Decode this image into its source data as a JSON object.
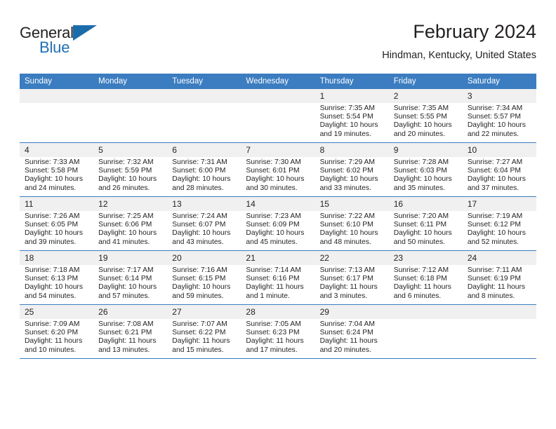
{
  "logo": {
    "word_one": "General",
    "word_two": "Blue",
    "triangle_color": "#1b6cab",
    "blue_color": "#1f6fb2"
  },
  "header": {
    "month_title": "February 2024",
    "location": "Hindman, Kentucky, United States",
    "header_bg": "#3b7dc0",
    "daynum_bg": "#f0f0f0"
  },
  "weekday_headers": [
    "Sunday",
    "Monday",
    "Tuesday",
    "Wednesday",
    "Thursday",
    "Friday",
    "Saturday"
  ],
  "weeks": [
    [
      {
        "day": "",
        "sunrise": "",
        "sunset": "",
        "daylight_1": "",
        "daylight_2": ""
      },
      {
        "day": "",
        "sunrise": "",
        "sunset": "",
        "daylight_1": "",
        "daylight_2": ""
      },
      {
        "day": "",
        "sunrise": "",
        "sunset": "",
        "daylight_1": "",
        "daylight_2": ""
      },
      {
        "day": "",
        "sunrise": "",
        "sunset": "",
        "daylight_1": "",
        "daylight_2": ""
      },
      {
        "day": "1",
        "sunrise": "Sunrise: 7:35 AM",
        "sunset": "Sunset: 5:54 PM",
        "daylight_1": "Daylight: 10 hours",
        "daylight_2": "and 19 minutes."
      },
      {
        "day": "2",
        "sunrise": "Sunrise: 7:35 AM",
        "sunset": "Sunset: 5:55 PM",
        "daylight_1": "Daylight: 10 hours",
        "daylight_2": "and 20 minutes."
      },
      {
        "day": "3",
        "sunrise": "Sunrise: 7:34 AM",
        "sunset": "Sunset: 5:57 PM",
        "daylight_1": "Daylight: 10 hours",
        "daylight_2": "and 22 minutes."
      }
    ],
    [
      {
        "day": "4",
        "sunrise": "Sunrise: 7:33 AM",
        "sunset": "Sunset: 5:58 PM",
        "daylight_1": "Daylight: 10 hours",
        "daylight_2": "and 24 minutes."
      },
      {
        "day": "5",
        "sunrise": "Sunrise: 7:32 AM",
        "sunset": "Sunset: 5:59 PM",
        "daylight_1": "Daylight: 10 hours",
        "daylight_2": "and 26 minutes."
      },
      {
        "day": "6",
        "sunrise": "Sunrise: 7:31 AM",
        "sunset": "Sunset: 6:00 PM",
        "daylight_1": "Daylight: 10 hours",
        "daylight_2": "and 28 minutes."
      },
      {
        "day": "7",
        "sunrise": "Sunrise: 7:30 AM",
        "sunset": "Sunset: 6:01 PM",
        "daylight_1": "Daylight: 10 hours",
        "daylight_2": "and 30 minutes."
      },
      {
        "day": "8",
        "sunrise": "Sunrise: 7:29 AM",
        "sunset": "Sunset: 6:02 PM",
        "daylight_1": "Daylight: 10 hours",
        "daylight_2": "and 33 minutes."
      },
      {
        "day": "9",
        "sunrise": "Sunrise: 7:28 AM",
        "sunset": "Sunset: 6:03 PM",
        "daylight_1": "Daylight: 10 hours",
        "daylight_2": "and 35 minutes."
      },
      {
        "day": "10",
        "sunrise": "Sunrise: 7:27 AM",
        "sunset": "Sunset: 6:04 PM",
        "daylight_1": "Daylight: 10 hours",
        "daylight_2": "and 37 minutes."
      }
    ],
    [
      {
        "day": "11",
        "sunrise": "Sunrise: 7:26 AM",
        "sunset": "Sunset: 6:05 PM",
        "daylight_1": "Daylight: 10 hours",
        "daylight_2": "and 39 minutes."
      },
      {
        "day": "12",
        "sunrise": "Sunrise: 7:25 AM",
        "sunset": "Sunset: 6:06 PM",
        "daylight_1": "Daylight: 10 hours",
        "daylight_2": "and 41 minutes."
      },
      {
        "day": "13",
        "sunrise": "Sunrise: 7:24 AM",
        "sunset": "Sunset: 6:07 PM",
        "daylight_1": "Daylight: 10 hours",
        "daylight_2": "and 43 minutes."
      },
      {
        "day": "14",
        "sunrise": "Sunrise: 7:23 AM",
        "sunset": "Sunset: 6:09 PM",
        "daylight_1": "Daylight: 10 hours",
        "daylight_2": "and 45 minutes."
      },
      {
        "day": "15",
        "sunrise": "Sunrise: 7:22 AM",
        "sunset": "Sunset: 6:10 PM",
        "daylight_1": "Daylight: 10 hours",
        "daylight_2": "and 48 minutes."
      },
      {
        "day": "16",
        "sunrise": "Sunrise: 7:20 AM",
        "sunset": "Sunset: 6:11 PM",
        "daylight_1": "Daylight: 10 hours",
        "daylight_2": "and 50 minutes."
      },
      {
        "day": "17",
        "sunrise": "Sunrise: 7:19 AM",
        "sunset": "Sunset: 6:12 PM",
        "daylight_1": "Daylight: 10 hours",
        "daylight_2": "and 52 minutes."
      }
    ],
    [
      {
        "day": "18",
        "sunrise": "Sunrise: 7:18 AM",
        "sunset": "Sunset: 6:13 PM",
        "daylight_1": "Daylight: 10 hours",
        "daylight_2": "and 54 minutes."
      },
      {
        "day": "19",
        "sunrise": "Sunrise: 7:17 AM",
        "sunset": "Sunset: 6:14 PM",
        "daylight_1": "Daylight: 10 hours",
        "daylight_2": "and 57 minutes."
      },
      {
        "day": "20",
        "sunrise": "Sunrise: 7:16 AM",
        "sunset": "Sunset: 6:15 PM",
        "daylight_1": "Daylight: 10 hours",
        "daylight_2": "and 59 minutes."
      },
      {
        "day": "21",
        "sunrise": "Sunrise: 7:14 AM",
        "sunset": "Sunset: 6:16 PM",
        "daylight_1": "Daylight: 11 hours",
        "daylight_2": "and 1 minute."
      },
      {
        "day": "22",
        "sunrise": "Sunrise: 7:13 AM",
        "sunset": "Sunset: 6:17 PM",
        "daylight_1": "Daylight: 11 hours",
        "daylight_2": "and 3 minutes."
      },
      {
        "day": "23",
        "sunrise": "Sunrise: 7:12 AM",
        "sunset": "Sunset: 6:18 PM",
        "daylight_1": "Daylight: 11 hours",
        "daylight_2": "and 6 minutes."
      },
      {
        "day": "24",
        "sunrise": "Sunrise: 7:11 AM",
        "sunset": "Sunset: 6:19 PM",
        "daylight_1": "Daylight: 11 hours",
        "daylight_2": "and 8 minutes."
      }
    ],
    [
      {
        "day": "25",
        "sunrise": "Sunrise: 7:09 AM",
        "sunset": "Sunset: 6:20 PM",
        "daylight_1": "Daylight: 11 hours",
        "daylight_2": "and 10 minutes."
      },
      {
        "day": "26",
        "sunrise": "Sunrise: 7:08 AM",
        "sunset": "Sunset: 6:21 PM",
        "daylight_1": "Daylight: 11 hours",
        "daylight_2": "and 13 minutes."
      },
      {
        "day": "27",
        "sunrise": "Sunrise: 7:07 AM",
        "sunset": "Sunset: 6:22 PM",
        "daylight_1": "Daylight: 11 hours",
        "daylight_2": "and 15 minutes."
      },
      {
        "day": "28",
        "sunrise": "Sunrise: 7:05 AM",
        "sunset": "Sunset: 6:23 PM",
        "daylight_1": "Daylight: 11 hours",
        "daylight_2": "and 17 minutes."
      },
      {
        "day": "29",
        "sunrise": "Sunrise: 7:04 AM",
        "sunset": "Sunset: 6:24 PM",
        "daylight_1": "Daylight: 11 hours",
        "daylight_2": "and 20 minutes."
      },
      {
        "day": "",
        "sunrise": "",
        "sunset": "",
        "daylight_1": "",
        "daylight_2": ""
      },
      {
        "day": "",
        "sunrise": "",
        "sunset": "",
        "daylight_1": "",
        "daylight_2": ""
      }
    ]
  ]
}
